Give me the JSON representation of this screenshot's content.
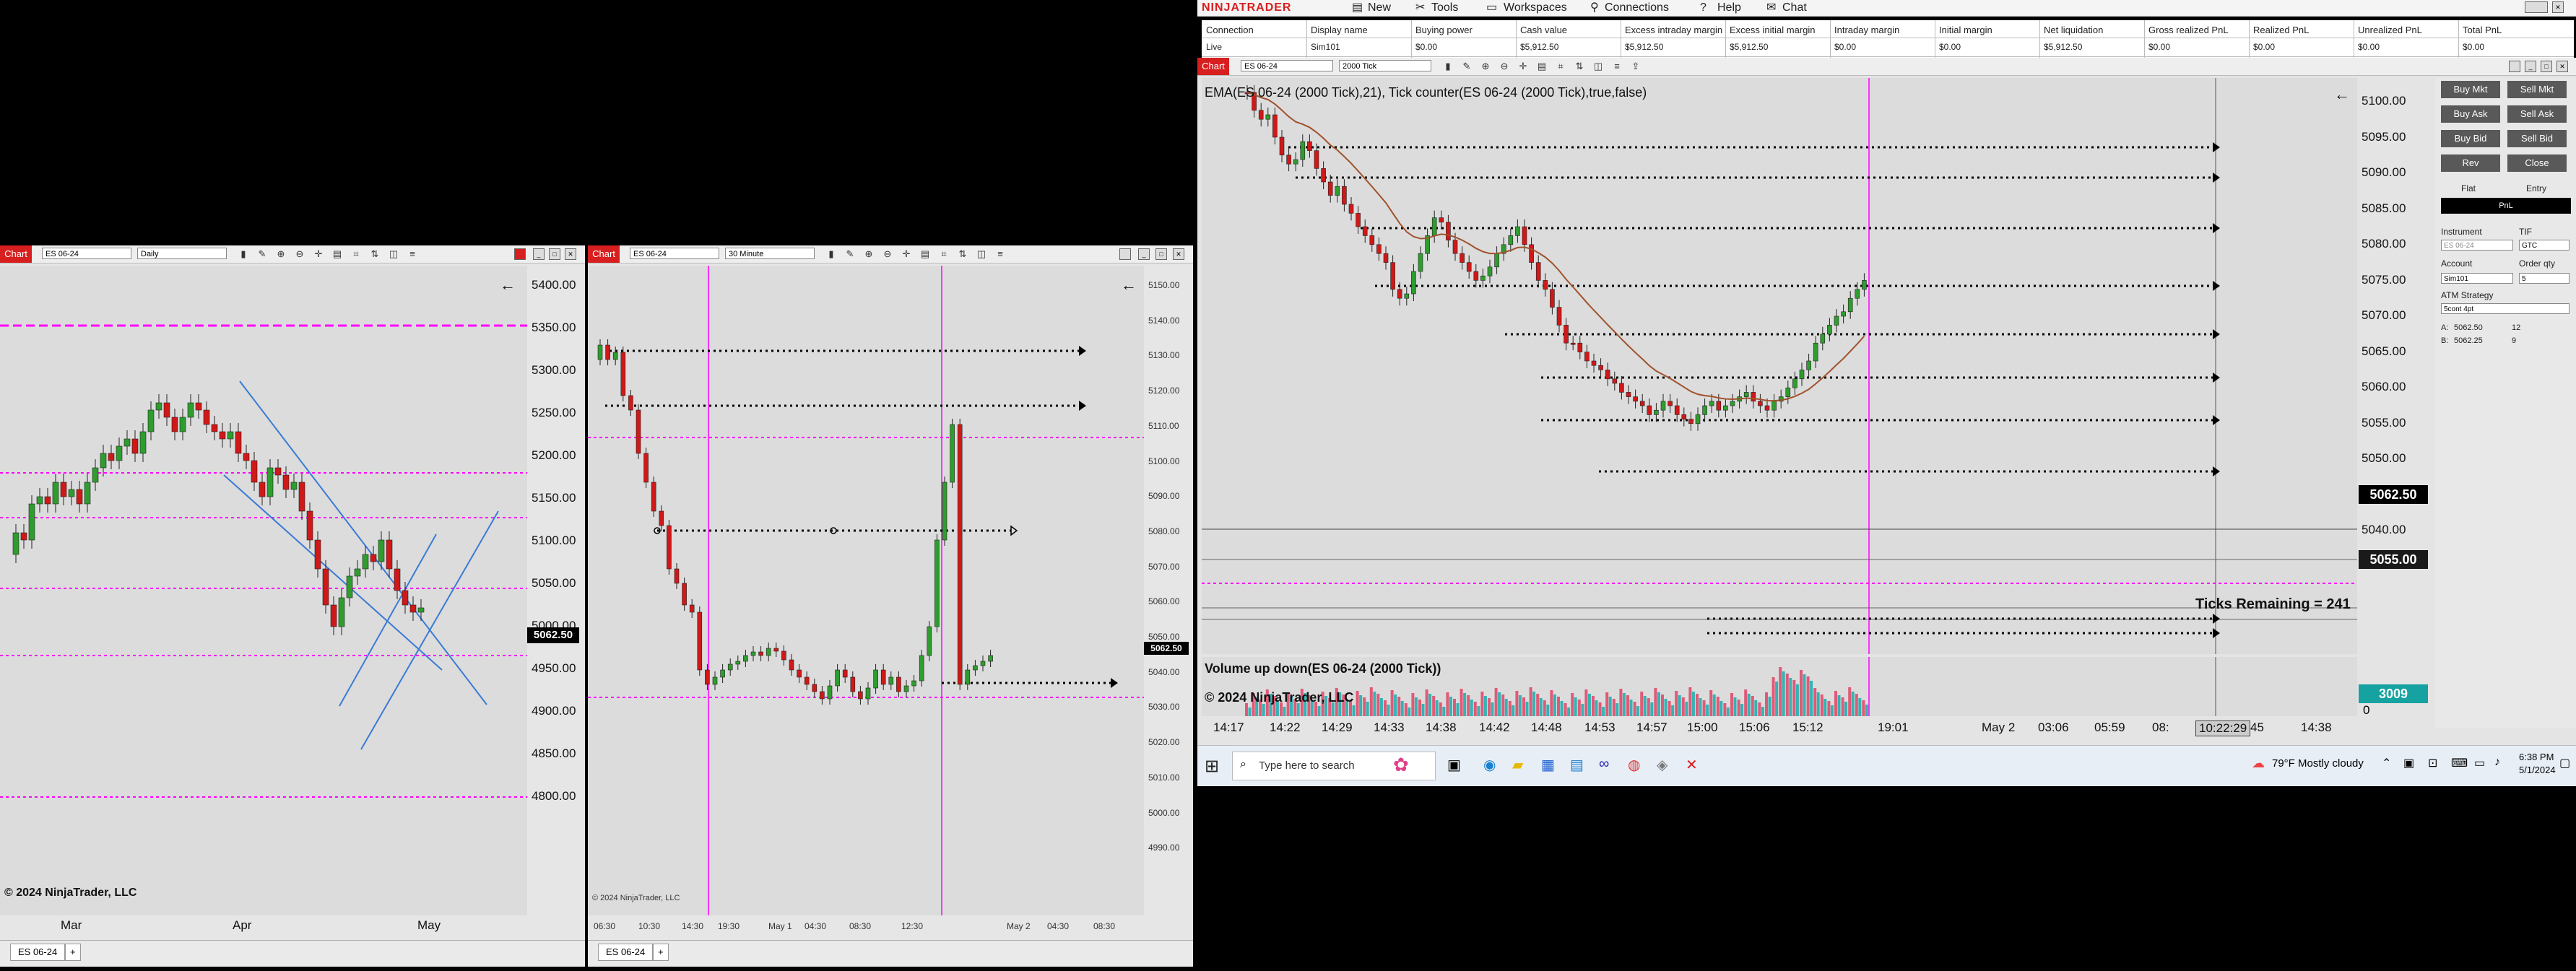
{
  "left_chart": {
    "tag": "Chart",
    "instrument": "ES 06-24",
    "period": "Daily",
    "price_labels": [
      "5400.00",
      "5350.00",
      "5300.00",
      "5250.00",
      "5200.00",
      "5150.00",
      "5100.00",
      "5050.00",
      "5000.00",
      "4950.00",
      "4900.00",
      "4850.00",
      "4800.00"
    ],
    "last_price": "5062.50",
    "x_labels": [
      "Mar",
      "Apr",
      "May"
    ],
    "copyright": "© 2024 NinjaTrader, LLC",
    "tab": "ES 06-24",
    "add_tab": "+"
  },
  "mid_chart": {
    "tag": "Chart",
    "instrument": "ES 06-24",
    "period": "30 Minute",
    "price_labels": [
      "5150.00",
      "5140.00",
      "5130.00",
      "5120.00",
      "5110.00",
      "5100.00",
      "5090.00",
      "5080.00",
      "5070.00",
      "5060.00",
      "5050.00",
      "5040.00",
      "5030.00",
      "5020.00",
      "5010.00",
      "5000.00",
      "4990.00"
    ],
    "last_price": "5062.50",
    "x_labels": [
      "06:30",
      "10:30",
      "14:30",
      "19:30",
      "May 1",
      "04:30",
      "08:30",
      "12:30",
      "May 2",
      "04:30",
      "08:30"
    ],
    "copyright": "© 2024 NinjaTrader, LLC",
    "tab": "ES 06-24",
    "add_tab": "+"
  },
  "menu": {
    "brand": "NINJATRADER",
    "new": "New",
    "tools": "Tools",
    "workspaces": "Workspaces",
    "connections": "Connections",
    "help": "Help",
    "chat": "Chat"
  },
  "accounts": {
    "headers": [
      "Connection",
      "Display name",
      "Buying power",
      "Cash value",
      "Excess intraday margin",
      "Excess initial margin",
      "Intraday margin",
      "Initial margin",
      "Net liquidation",
      "Gross realized PnL",
      "Realized PnL",
      "Unrealized PnL",
      "Total PnL"
    ],
    "row": [
      "Live",
      "Sim101",
      "$0.00",
      "$5,912.50",
      "$5,912.50",
      "$5,912.50",
      "$0.00",
      "$0.00",
      "$5,912.50",
      "$0.00",
      "$0.00",
      "$0.00",
      "$0.00"
    ]
  },
  "main_chart": {
    "tag": "Chart",
    "instrument": "ES 06-24",
    "period": "2000 Tick",
    "indicator_label": "EMA(ES 06-24 (2000 Tick),21), Tick counter(ES 06-24 (2000 Tick),true,false)",
    "volume_label": "Volume up down(ES 06-24 (2000 Tick))",
    "copyright": "© 2024 NinjaTrader, LLC",
    "ticks_remaining": "Ticks Remaining = 241",
    "price_labels": [
      "5100.00",
      "5095.00",
      "5090.00",
      "5085.00",
      "5080.00",
      "5075.00",
      "5070.00",
      "5065.00",
      "5060.00",
      "5055.00",
      "5050.00",
      "5045.00",
      "5040.00"
    ],
    "last_price": "5062.50",
    "line_price": "5055.00",
    "volume_value": "3009",
    "volume_zero": "0",
    "x_labels": [
      "14:17",
      "14:22",
      "14:29",
      "14:33",
      "14:38",
      "14:42",
      "14:48",
      "14:53",
      "14:57",
      "15:00",
      "15:06",
      "15:12",
      "19:01",
      "May 2",
      "03:06",
      "05:59",
      "08:",
      "10:22:29",
      "45",
      "14:38"
    ]
  },
  "chart_trader": {
    "buy_mkt": "Buy Mkt",
    "sell_mkt": "Sell Mkt",
    "buy_ask": "Buy Ask",
    "sell_ask": "Sell Ask",
    "buy_bid": "Buy Bid",
    "sell_bid": "Sell Bid",
    "rev": "Rev",
    "close": "Close",
    "flat": "Flat",
    "entry": "Entry",
    "pnl": "PnL",
    "instrument_label": "Instrument",
    "instrument_value": "ES 06-24",
    "tif_label": "TIF",
    "tif_value": "GTC",
    "account_label": "Account",
    "account_value": "Sim101",
    "qty_label": "Order qty",
    "qty_value": "5",
    "atm_label": "ATM Strategy",
    "atm_value": "5cont 4pt",
    "ask_label": "A:",
    "ask_price": "5062.50",
    "ask_size": "12",
    "bid_label": "B:",
    "bid_price": "5062.25",
    "bid_size": "9"
  },
  "taskbar": {
    "search_placeholder": "Type here to search",
    "weather": "79°F  Mostly cloudy",
    "time": "6:38 PM",
    "date": "5/1/2024"
  }
}
